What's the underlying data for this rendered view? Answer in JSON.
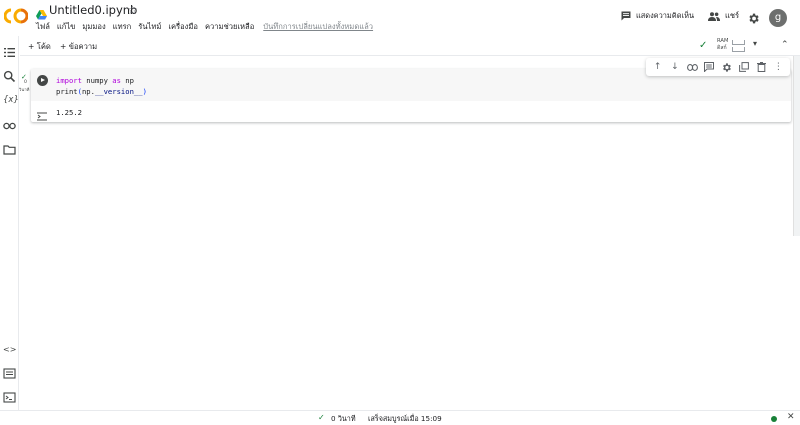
{
  "header": {
    "title": "Untitled0.ipynb",
    "menu": [
      "ไฟล์",
      "แก้ไข",
      "มุมมอง",
      "แทรก",
      "รันไทม์",
      "เครื่องมือ",
      "ความช่วยเหลือ"
    ],
    "saved_status": "บันทึกการเปลี่ยนแปลงทั้งหมดแล้ว",
    "comment_label": "แสดงความคิดเห็น",
    "share_label": "แชร์",
    "avatar_letter": "g"
  },
  "toolbar": {
    "add_code": "+ โค้ด",
    "add_text": "+ ข้อความ",
    "ram_label": "RAM",
    "disk_label": "ดิสก์"
  },
  "cell": {
    "code_line1_kw1": "import",
    "code_line1_mod": " numpy ",
    "code_line1_kw2": "as",
    "code_line1_alias": " np",
    "code_line2_fn": "print",
    "code_line2_open": "(",
    "code_line2_obj": "np.",
    "code_line2_attr": "__version__",
    "code_line2_close": ")",
    "exec_count": "0",
    "exec_time": "วินาที",
    "output": "1.25.2"
  },
  "status": {
    "elapsed": "0 วินาที",
    "completed": "เสร็จสมบูรณ์เมื่อ 15:09"
  },
  "colors": {
    "accent_orange": "#f9ab00",
    "connected_green": "#188038",
    "keyword_purple": "#af00db"
  }
}
